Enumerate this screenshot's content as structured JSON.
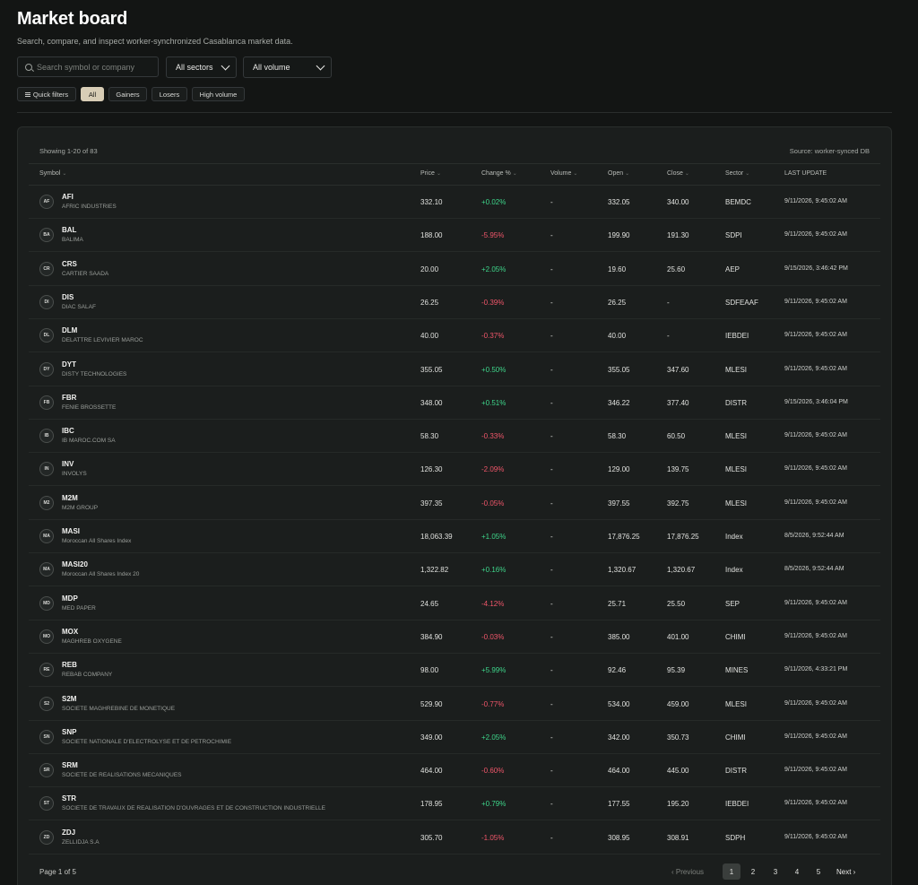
{
  "header": {
    "title": "Market board",
    "subtitle": "Search, compare, and inspect worker-synchronized Casablanca market data."
  },
  "search": {
    "placeholder": "Search symbol or company",
    "value": ""
  },
  "filters": {
    "sector": "All sectors",
    "volume": "All volume"
  },
  "chips": {
    "quick": "Quick filters",
    "all": "All",
    "gainers": "Gainers",
    "losers": "Losers",
    "high_volume": "High volume",
    "active": "All"
  },
  "table": {
    "showing": "Showing 1-20 of 83",
    "source": "Source: worker-synced DB",
    "columns": {
      "symbol": "Symbol",
      "price": "Price",
      "change": "Change %",
      "volume": "Volume",
      "open": "Open",
      "close": "Close",
      "sector": "Sector",
      "last_update": "LAST UPDATE"
    },
    "rows": [
      {
        "initials": "AF",
        "symbol": "AFI",
        "name": "AFRIC INDUSTRIES",
        "price": "332.10",
        "change": "+0.02%",
        "dir": "pos",
        "volume": "-",
        "open": "332.05",
        "close": "340.00",
        "sector": "BEMDC",
        "updated": "9/11/2026, 9:45:02 AM"
      },
      {
        "initials": "BA",
        "symbol": "BAL",
        "name": "BALIMA",
        "price": "188.00",
        "change": "-5.95%",
        "dir": "neg",
        "volume": "-",
        "open": "199.90",
        "close": "191.30",
        "sector": "SDPI",
        "updated": "9/11/2026, 9:45:02 AM"
      },
      {
        "initials": "CR",
        "symbol": "CRS",
        "name": "CARTIER SAADA",
        "price": "20.00",
        "change": "+2.05%",
        "dir": "pos",
        "volume": "-",
        "open": "19.60",
        "close": "25.60",
        "sector": "AEP",
        "updated": "9/15/2026, 3:46:42 PM"
      },
      {
        "initials": "DI",
        "symbol": "DIS",
        "name": "DIAC SALAF",
        "price": "26.25",
        "change": "-0.39%",
        "dir": "neg",
        "volume": "-",
        "open": "26.25",
        "close": "-",
        "sector": "SDFEAAF",
        "updated": "9/11/2026, 9:45:02 AM"
      },
      {
        "initials": "DL",
        "symbol": "DLM",
        "name": "DELATTRE LEVIVIER MAROC",
        "price": "40.00",
        "change": "-0.37%",
        "dir": "neg",
        "volume": "-",
        "open": "40.00",
        "close": "-",
        "sector": "IEBDEI",
        "updated": "9/11/2026, 9:45:02 AM"
      },
      {
        "initials": "DY",
        "symbol": "DYT",
        "name": "DISTY TECHNOLOGIES",
        "price": "355.05",
        "change": "+0.50%",
        "dir": "pos",
        "volume": "-",
        "open": "355.05",
        "close": "347.60",
        "sector": "MLESI",
        "updated": "9/11/2026, 9:45:02 AM"
      },
      {
        "initials": "FB",
        "symbol": "FBR",
        "name": "FENIE BROSSETTE",
        "price": "348.00",
        "change": "+0.51%",
        "dir": "pos",
        "volume": "-",
        "open": "346.22",
        "close": "377.40",
        "sector": "DISTR",
        "updated": "9/15/2026, 3:46:04 PM"
      },
      {
        "initials": "IB",
        "symbol": "IBC",
        "name": "IB MAROC.COM SA",
        "price": "58.30",
        "change": "-0.33%",
        "dir": "neg",
        "volume": "-",
        "open": "58.30",
        "close": "60.50",
        "sector": "MLESI",
        "updated": "9/11/2026, 9:45:02 AM"
      },
      {
        "initials": "IN",
        "symbol": "INV",
        "name": "INVOLYS",
        "price": "126.30",
        "change": "-2.09%",
        "dir": "neg",
        "volume": "-",
        "open": "129.00",
        "close": "139.75",
        "sector": "MLESI",
        "updated": "9/11/2026, 9:45:02 AM"
      },
      {
        "initials": "M2",
        "symbol": "M2M",
        "name": "M2M GROUP",
        "price": "397.35",
        "change": "-0.05%",
        "dir": "neg",
        "volume": "-",
        "open": "397.55",
        "close": "392.75",
        "sector": "MLESI",
        "updated": "9/11/2026, 9:45:02 AM"
      },
      {
        "initials": "MA",
        "symbol": "MASI",
        "name": "Moroccan All Shares Index",
        "price": "18,063.39",
        "change": "+1.05%",
        "dir": "pos",
        "volume": "-",
        "open": "17,876.25",
        "close": "17,876.25",
        "sector": "Index",
        "updated": "8/5/2026, 9:52:44 AM"
      },
      {
        "initials": "MA",
        "symbol": "MASI20",
        "name": "Moroccan All Shares Index 20",
        "price": "1,322.82",
        "change": "+0.16%",
        "dir": "pos",
        "volume": "-",
        "open": "1,320.67",
        "close": "1,320.67",
        "sector": "Index",
        "updated": "8/5/2026, 9:52:44 AM"
      },
      {
        "initials": "MD",
        "symbol": "MDP",
        "name": "MED PAPER",
        "price": "24.65",
        "change": "-4.12%",
        "dir": "neg",
        "volume": "-",
        "open": "25.71",
        "close": "25.50",
        "sector": "SEP",
        "updated": "9/11/2026, 9:45:02 AM"
      },
      {
        "initials": "MO",
        "symbol": "MOX",
        "name": "MAGHREB OXYGENE",
        "price": "384.90",
        "change": "-0.03%",
        "dir": "neg",
        "volume": "-",
        "open": "385.00",
        "close": "401.00",
        "sector": "CHIMI",
        "updated": "9/11/2026, 9:45:02 AM"
      },
      {
        "initials": "RE",
        "symbol": "REB",
        "name": "REBAB COMPANY",
        "price": "98.00",
        "change": "+5.99%",
        "dir": "pos",
        "volume": "-",
        "open": "92.46",
        "close": "95.39",
        "sector": "MINES",
        "updated": "9/11/2026, 4:33:21 PM"
      },
      {
        "initials": "S2",
        "symbol": "S2M",
        "name": "SOCIETE MAGHREBINE DE MONETIQUE",
        "price": "529.90",
        "change": "-0.77%",
        "dir": "neg",
        "volume": "-",
        "open": "534.00",
        "close": "459.00",
        "sector": "MLESI",
        "updated": "9/11/2026, 9:45:02 AM"
      },
      {
        "initials": "SN",
        "symbol": "SNP",
        "name": "SOCIETE NATIONALE D'ELECTROLYSE ET DE PETROCHIMIE",
        "price": "349.00",
        "change": "+2.05%",
        "dir": "pos",
        "volume": "-",
        "open": "342.00",
        "close": "350.73",
        "sector": "CHIMI",
        "updated": "9/11/2026, 9:45:02 AM"
      },
      {
        "initials": "SR",
        "symbol": "SRM",
        "name": "SOCIETE DE REALISATIONS MECANIQUES",
        "price": "464.00",
        "change": "-0.60%",
        "dir": "neg",
        "volume": "-",
        "open": "464.00",
        "close": "445.00",
        "sector": "DISTR",
        "updated": "9/11/2026, 9:45:02 AM"
      },
      {
        "initials": "ST",
        "symbol": "STR",
        "name": "SOCIETE DE TRAVAUX DE REALISATION D'OUVRAGES ET DE CONSTRUCTION INDUSTRIELLE",
        "price": "178.95",
        "change": "+0.79%",
        "dir": "pos",
        "volume": "-",
        "open": "177.55",
        "close": "195.20",
        "sector": "IEBDEI",
        "updated": "9/11/2026, 9:45:02 AM"
      },
      {
        "initials": "ZD",
        "symbol": "ZDJ",
        "name": "ZELLIDJA S.A",
        "price": "305.70",
        "change": "-1.05%",
        "dir": "neg",
        "volume": "-",
        "open": "308.95",
        "close": "308.91",
        "sector": "SDPH",
        "updated": "9/11/2026, 9:45:02 AM"
      }
    ]
  },
  "pagination": {
    "label": "Page 1 of 5",
    "previous": "Previous",
    "next": "Next",
    "pages": [
      "1",
      "2",
      "3",
      "4",
      "5"
    ],
    "current": "1"
  },
  "colors": {
    "background": "#131514",
    "panel": "#1b1e1d",
    "positive": "#3ed58a",
    "negative": "#f0566a",
    "active_chip": "#d8cdb6"
  }
}
